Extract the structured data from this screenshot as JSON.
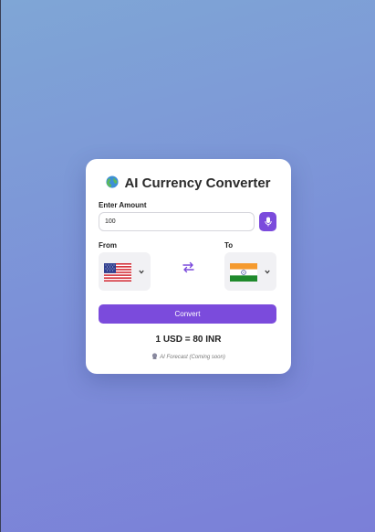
{
  "app": {
    "title": "AI Currency Converter"
  },
  "amount": {
    "label": "Enter Amount",
    "value": "100"
  },
  "from": {
    "label": "From",
    "currency_icon": "us-flag-icon"
  },
  "to": {
    "label": "To",
    "currency_icon": "india-flag-icon"
  },
  "actions": {
    "convert_label": "Convert"
  },
  "result": {
    "text": "1 USD = 80 INR"
  },
  "forecast": {
    "text": "AI Forecast (Coming soon)"
  },
  "colors": {
    "accent": "#7b4bdc",
    "background_top": "#7fa6d6",
    "background_bottom": "#7b7fd8"
  }
}
